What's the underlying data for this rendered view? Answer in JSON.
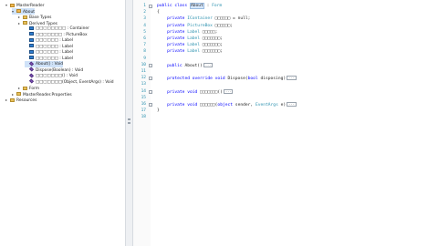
{
  "tree": [
    {
      "label": "MasterReader",
      "icon": "class-icon",
      "indent": 0,
      "toggle": "▾",
      "top": 0
    },
    {
      "label": "About",
      "icon": "class-icon",
      "indent": 1,
      "toggle": "▾",
      "selected": true
    },
    {
      "label": "Base Types",
      "icon": "folder-icon",
      "indent": 2,
      "toggle": "▸"
    },
    {
      "label": "Derived Types",
      "icon": "folder-icon",
      "indent": 2,
      "toggle": "▸"
    },
    {
      "label": "□□□□□□□□ : Container",
      "icon": "field-icon",
      "indent": 3,
      "toggle": ""
    },
    {
      "label": "□□□□□□□ : PictureBox",
      "icon": "field-icon",
      "indent": 3,
      "toggle": ""
    },
    {
      "label": "□□□□□□ : Label",
      "icon": "field-icon",
      "indent": 3,
      "toggle": ""
    },
    {
      "label": "□□□□□□ : Label",
      "icon": "field-icon",
      "indent": 3,
      "toggle": ""
    },
    {
      "label": "□□□□□□ : Label",
      "icon": "field-icon",
      "indent": 3,
      "toggle": ""
    },
    {
      "label": "□□□□□□ : Label",
      "icon": "field-icon",
      "indent": 3,
      "toggle": ""
    },
    {
      "label": "About() : Void",
      "icon": "method-icon",
      "indent": 3,
      "toggle": "",
      "selected": true
    },
    {
      "label": "Dispose(Boolean) : Void",
      "icon": "method-icon",
      "indent": 3,
      "toggle": ""
    },
    {
      "label": "□□□□□□□() : Void",
      "icon": "method-icon",
      "indent": 3,
      "toggle": ""
    },
    {
      "label": "□□□□□□□(Object, EventArgs) : Void",
      "icon": "method-icon",
      "indent": 3,
      "toggle": ""
    },
    {
      "label": "Form",
      "icon": "folder-icon",
      "indent": 2,
      "toggle": "▸"
    },
    {
      "label": "MasterReader.Properties",
      "icon": "folder-icon",
      "indent": 1,
      "toggle": "▸"
    },
    {
      "label": "Resources",
      "icon": "folder-icon",
      "indent": 0,
      "toggle": "▸"
    }
  ],
  "code": [
    {
      "n": "1",
      "fold": "-",
      "html": "<span class='kw'>public class</span> <span class='hl'>About</span> : <span class='ty'>Form</span>"
    },
    {
      "n": "2",
      "fold": "",
      "html": "{"
    },
    {
      "n": "3",
      "fold": "",
      "html": "    <span class='kw'>private</span> <span class='ty'>IContainer</span> □□□□□□ = null;"
    },
    {
      "n": "4",
      "fold": "",
      "html": "    <span class='kw'>private</span> <span class='ty'>PictureBox</span> □□□□□□;"
    },
    {
      "n": "5",
      "fold": "",
      "html": "    <span class='kw'>private</span> <span class='ty'>Label</span> □□□□□;"
    },
    {
      "n": "6",
      "fold": "",
      "html": "    <span class='kw'>private</span> <span class='ty'>Label</span> □□□□□□□;"
    },
    {
      "n": "7",
      "fold": "",
      "html": "    <span class='kw'>private</span> <span class='ty'>Label</span> □□□□□□□;"
    },
    {
      "n": "8",
      "fold": "",
      "html": "    <span class='kw'>private</span> <span class='ty'>Label</span> □□□□□□□;"
    },
    {
      "n": "9",
      "fold": "",
      "html": ""
    },
    {
      "n": "10",
      "fold": "-",
      "html": "    <span class='kw'>public</span> About()<span class='box'>...</span>"
    },
    {
      "n": "11",
      "fold": "",
      "html": ""
    },
    {
      "n": "12",
      "fold": "-",
      "html": "    <span class='kw'>protected override void</span> Dispose(<span class='kw'>bool</span> disposing)<span class='box'>...</span>"
    },
    {
      "n": "13",
      "fold": "",
      "html": ""
    },
    {
      "n": "14",
      "fold": "-",
      "html": "    <span class='kw'>private void</span> □□□□□□□()<span class='box'>...</span>"
    },
    {
      "n": "15",
      "fold": "",
      "html": ""
    },
    {
      "n": "16",
      "fold": "-",
      "html": "    <span class='kw'>private void</span> □□□□□□(<span class='kw'>object</span> sender, <span class='ty'>EventArgs</span> e)<span class='box'>...</span>"
    },
    {
      "n": "17",
      "fold": "",
      "html": "}"
    },
    {
      "n": "18",
      "fold": "",
      "html": ""
    }
  ]
}
